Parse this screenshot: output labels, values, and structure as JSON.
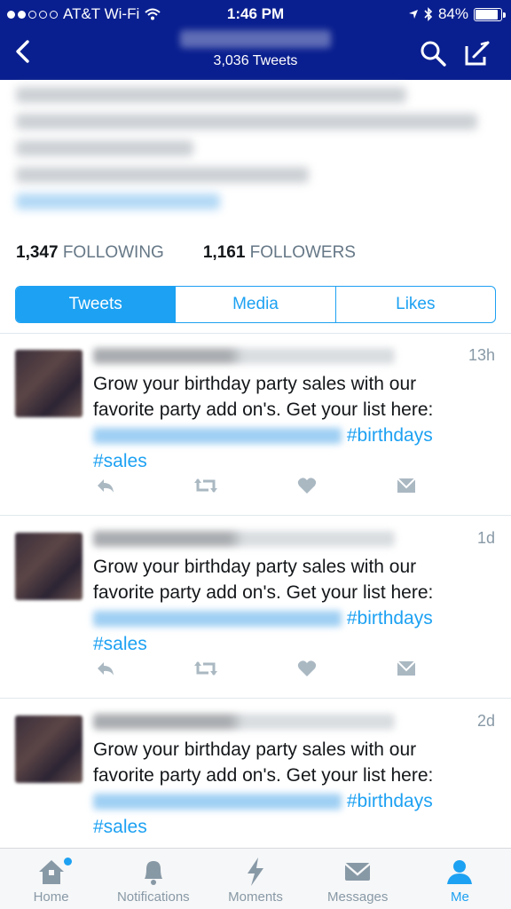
{
  "status_bar": {
    "carrier": "AT&T Wi-Fi",
    "time": "1:46 PM",
    "battery": "84%",
    "battery_level": 0.84
  },
  "header": {
    "tweet_count": "3,036 Tweets",
    "back_icon": "chevron-left-icon",
    "search_icon": "search-icon",
    "compose_icon": "compose-icon"
  },
  "profile": {
    "following_count": "1,347",
    "following_label": "FOLLOWING",
    "followers_count": "1,161",
    "followers_label": "FOLLOWERS"
  },
  "tabs": [
    {
      "label": "Tweets",
      "active": true
    },
    {
      "label": "Media",
      "active": false
    },
    {
      "label": "Likes",
      "active": false
    }
  ],
  "tweets": [
    {
      "time": "13h",
      "line1": "Grow your birthday party sales with our",
      "line2": "favorite party add on's. Get your list here:",
      "hashtag1": "#birthdays",
      "hashtag2": "#sales"
    },
    {
      "time": "1d",
      "line1": "Grow your birthday party sales with our",
      "line2": "favorite party add on's. Get your list here:",
      "hashtag1": "#birthdays",
      "hashtag2": "#sales"
    },
    {
      "time": "2d",
      "line1": "Grow your birthday party sales with our",
      "line2": "favorite party add on's. Get your list here:",
      "hashtag1": "#birthdays",
      "hashtag2": "#sales"
    }
  ],
  "tabbar": [
    {
      "label": "Home",
      "icon": "home-icon"
    },
    {
      "label": "Notifications",
      "icon": "bell-icon"
    },
    {
      "label": "Moments",
      "icon": "lightning-icon"
    },
    {
      "label": "Messages",
      "icon": "envelope-icon"
    },
    {
      "label": "Me",
      "icon": "person-icon",
      "active": true
    }
  ],
  "colors": {
    "header_bg": "#0a1f8f",
    "accent": "#1da1f2",
    "muted": "#8899a6"
  }
}
